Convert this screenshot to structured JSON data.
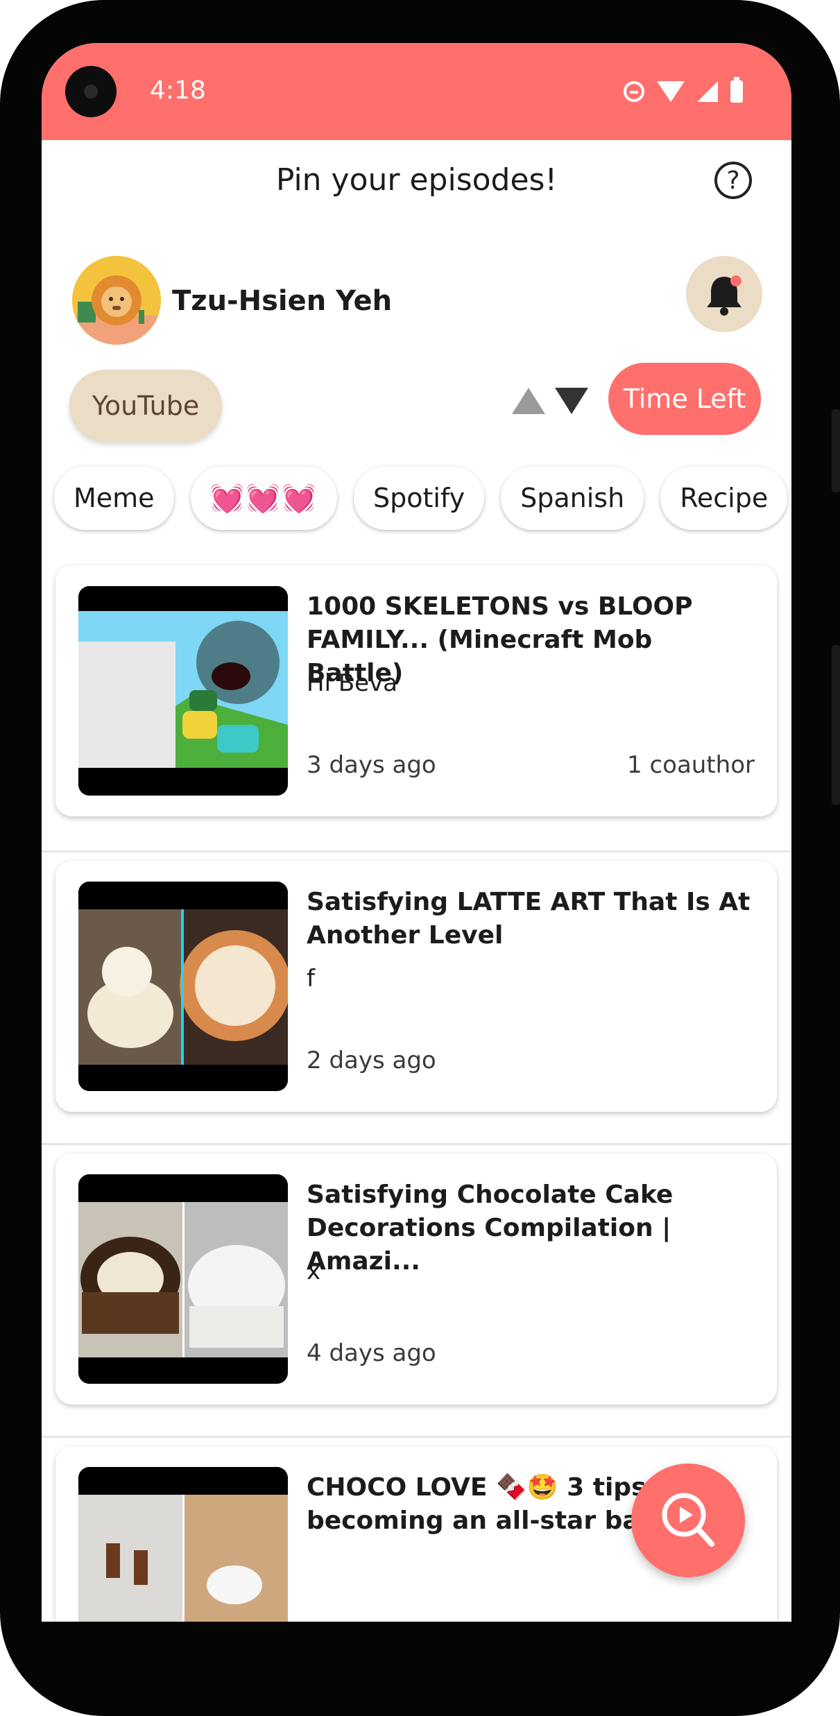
{
  "status_bar": {
    "time": "4:18"
  },
  "header": {
    "title": "Pin your episodes!",
    "help_label": "?"
  },
  "profile": {
    "name": "Tzu-Hsien Yeh"
  },
  "filters": {
    "source_chip": "YouTube",
    "sort_label": "Time Left"
  },
  "tags": [
    "Meme",
    "💓💓💓",
    "Spotify",
    "Spanish",
    "Recipe"
  ],
  "episodes": [
    {
      "title": "1000 SKELETONS vs BLOOP FAMILY... (Minecraft Mob Battle)",
      "author": "Hi Beva",
      "date": "3 days ago",
      "coauthors": "1 coauthor"
    },
    {
      "title": "Satisfying LATTE ART That Is At Another Level",
      "author": "f",
      "date": "2 days ago",
      "coauthors": ""
    },
    {
      "title": "Satisfying Chocolate Cake Decorations Compilation | Amazi...",
      "author": "x",
      "date": "4 days ago",
      "coauthors": ""
    },
    {
      "title": "CHOCO LOVE 🍫🤩 3 tips for becoming an all-star baker",
      "author": "",
      "date": "",
      "coauthors": ""
    }
  ],
  "colors": {
    "accent": "#FF6F6C",
    "chip_beige": "#EBDCC6"
  },
  "icons": [
    "help-icon",
    "bell-icon",
    "sort-up-icon",
    "sort-down-icon",
    "search-play-icon"
  ]
}
